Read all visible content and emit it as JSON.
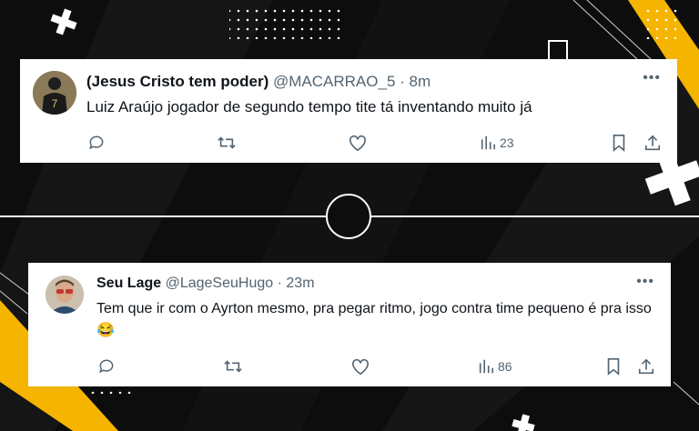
{
  "tweets": [
    {
      "name": "(Jesus Cristo tem poder)",
      "handle": "@MACARRAO_5",
      "separator": "·",
      "time": "8m",
      "text": "Luiz Araújo jogador de segundo tempo tite tá inventando muito já",
      "more": "•••",
      "views": "23",
      "avatar_icon": "avatar-player-silhouette"
    },
    {
      "name": "Seu Lage",
      "handle": "@LageSeuHugo",
      "separator": "·",
      "time": "23m",
      "text": "Tem que ir com o Ayrton mesmo, pra pegar ritmo, jogo contra time pequeno é pra isso 😂",
      "more": "•••",
      "views": "86",
      "avatar_icon": "avatar-man-sunglasses"
    }
  ],
  "colors": {
    "background": "#0d0d0d",
    "accent": "#f5b400",
    "card": "#ffffff",
    "text_primary": "#0f1419",
    "text_secondary": "#536471"
  }
}
